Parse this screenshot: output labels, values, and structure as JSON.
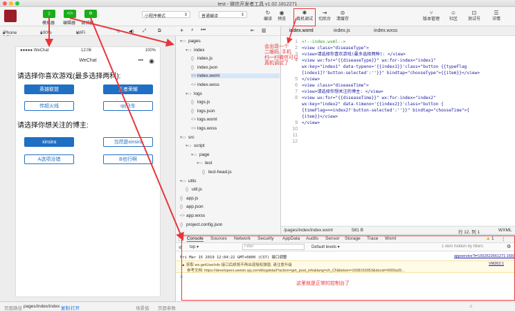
{
  "window": {
    "title": "test - 微信开发者工具 v1.02.1812271",
    "traffic_colors": [
      "#fc5f57",
      "#fdbc2e",
      "#2ac840"
    ]
  },
  "toolbar": {
    "buttons": [
      {
        "label": "模拟器",
        "icon": "phone-icon"
      },
      {
        "label": "编辑器",
        "icon": "code-icon"
      },
      {
        "label": "调试器",
        "icon": "debug-icon"
      }
    ],
    "mode_select": "小程序模式",
    "compile_select": "普通编译",
    "tools": [
      {
        "label": "编译",
        "icon": "refresh-icon"
      },
      {
        "label": "预览",
        "icon": "eye-icon"
      },
      {
        "label": "真机调试",
        "icon": "bug-icon"
      },
      {
        "label": "切后台",
        "icon": "switch-icon"
      },
      {
        "label": "清缓存",
        "icon": "layers-icon"
      }
    ],
    "right_tools": [
      {
        "label": "版本管理",
        "icon": "branch-icon"
      },
      {
        "label": "社区",
        "icon": "chat-icon"
      },
      {
        "label": "测试号",
        "icon": "test-icon"
      },
      {
        "label": "详情",
        "icon": "menu-icon"
      }
    ]
  },
  "subbar": {
    "device": "iPhone 6 Plus",
    "zoom": "100%",
    "network": "WiFi",
    "arrow": "▾"
  },
  "phone": {
    "carrier": "●●●●● WeChat",
    "time": "12:06",
    "battery": "100%",
    "nav_title": "WeChat",
    "nav_dots": "•••",
    "q1": "请选择你喜欢游戏(最多选择两科):",
    "games": [
      {
        "label": "英雄联盟",
        "selected": true
      },
      {
        "label": "王者荣耀",
        "selected": true
      },
      {
        "label": "传超火线",
        "selected": false
      },
      {
        "label": "qq飞车",
        "selected": false
      }
    ],
    "q2": "请选择你想关注的博主:",
    "bloggers": [
      {
        "label": "xinsira",
        "selected": true
      },
      {
        "label": "当然是xinsira",
        "selected": false
      },
      {
        "label": "A选项没错",
        "selected": false
      },
      {
        "label": "B也行啊",
        "selected": false
      }
    ]
  },
  "filetree": {
    "nodes": [
      {
        "label": "pages",
        "icon": "folder-icon",
        "depth": 0
      },
      {
        "label": "index",
        "icon": "folder-icon",
        "depth": 1
      },
      {
        "label": "index.js",
        "icon": "js-file-icon",
        "depth": 2
      },
      {
        "label": "index.json",
        "icon": "json-file-icon",
        "depth": 2
      },
      {
        "label": "index.wxml",
        "icon": "wxml-file-icon",
        "depth": 2,
        "selected": true
      },
      {
        "label": "index.wxss",
        "icon": "wxss-file-icon",
        "depth": 2
      },
      {
        "label": "logs",
        "icon": "folder-icon",
        "depth": 1
      },
      {
        "label": "logs.js",
        "icon": "js-file-icon",
        "depth": 2
      },
      {
        "label": "logs.json",
        "icon": "json-file-icon",
        "depth": 2
      },
      {
        "label": "logs.wxml",
        "icon": "wxml-file-icon",
        "depth": 2
      },
      {
        "label": "logs.wxss",
        "icon": "wxss-file-icon",
        "depth": 2
      },
      {
        "label": "src",
        "icon": "folder-icon",
        "depth": 0
      },
      {
        "label": "script",
        "icon": "folder-icon",
        "depth": 1
      },
      {
        "label": "page",
        "icon": "folder-icon",
        "depth": 2
      },
      {
        "label": "test",
        "icon": "folder-icon",
        "depth": 3
      },
      {
        "label": "test-head.js",
        "icon": "js-file-icon",
        "depth": 4
      },
      {
        "label": "utils",
        "icon": "folder-icon",
        "depth": 0
      },
      {
        "label": "util.js",
        "icon": "js-file-icon",
        "depth": 1
      },
      {
        "label": "app.js",
        "icon": "js-file-icon",
        "depth": 0
      },
      {
        "label": "app.json",
        "icon": "json-file-icon",
        "depth": 0
      },
      {
        "label": "app.wxss",
        "icon": "wxss-file-icon",
        "depth": 0
      },
      {
        "label": "project.config.json",
        "icon": "json-file-icon",
        "depth": 0
      }
    ]
  },
  "editor": {
    "tabs": [
      "index.wxml",
      "index.js",
      "index.wxss"
    ],
    "active_tab": "index.wxml",
    "lines": [
      {
        "n": "1",
        "text": "<!--index.wxml-->",
        "comment": true
      },
      {
        "n": "2",
        "text": "<view class=\"diseaseType\">"
      },
      {
        "n": "3",
        "text": "  <view>请选择你喜欢游戏(最多选择两种): </view>"
      },
      {
        "n": "4",
        "text": "  <view wx:for=\"{{diseaseType}}\" wx:for-index=\"index1\""
      },
      {
        "n": "",
        "text": "wx:key=\"index1\" data-typeno='{{index1}}'class=\"button {{typeFlag"
      },
      {
        "n": "",
        "text": "[index1]?'button-selected':''}}\" bindtap=\"chooseType\">{{item}}</view>"
      },
      {
        "n": "5",
        "text": "</view>"
      },
      {
        "n": "6",
        "text": "<view class=\"diseaseTime\">"
      },
      {
        "n": "7",
        "text": "  <view>请选择你想关注的博主: </view>"
      },
      {
        "n": "8",
        "text": "  <view wx:for=\"{{diseaseTime}}\" wx:for-index=\"index2\""
      },
      {
        "n": "",
        "text": "wx:key=\"index2\" data-timeno='{{index2}}'class=\"button {"
      },
      {
        "n": "",
        "text": "{timeFlag===index2?'button-selected':''}}\" bindtap=\"chooseTime\">{"
      },
      {
        "n": "",
        "text": "{item}}</view>"
      },
      {
        "n": "9",
        "text": "</view>"
      },
      {
        "n": "10",
        "text": ""
      },
      {
        "n": "11",
        "text": ""
      },
      {
        "n": "12",
        "text": ""
      }
    ],
    "status_path": "/pages/index/index.wxml",
    "status_size": "581 B",
    "status_pos": "行 12, 列 1",
    "status_lang": "WXML"
  },
  "devtools": {
    "tabs": [
      "Console",
      "Sources",
      "Network",
      "Security",
      "AppData",
      "Audits",
      "Sensor",
      "Storage",
      "Trace",
      "Wxml"
    ],
    "active_tab": "Console",
    "warn_count": "1",
    "context": "top",
    "filter_placeholder": "Filter",
    "levels": "Default levels ▾",
    "hidden_note": "1 item hidden by filters",
    "log1_time": "Fri Mar 15 2019 12:04:22 GMT+0800 (CST) 接口调整",
    "log1_src": "appservice?t=1552622661271:1693",
    "warn1": "▲ 获取 wx.getUserInfo 接口后续将不再出现授权弹窗, 请注意升级",
    "warn1_src": "VM262:1",
    "warn2": "参考文档: https://developers.weixin.qq.com/blogdetail?action=get_post_info&lang=zh_CN&token=1658163953&docid=0000a26...",
    "prompt": ">"
  },
  "bottombar": {
    "path_label": "页面路径",
    "path": "pages/index/index",
    "copy": "复制",
    "open": "打开",
    "scene": "场景值",
    "params": "页面参数"
  },
  "annotations": {
    "note1": "会出现一个",
    "note2": "二维码, 手机",
    "note3": "扫一扫微信可以",
    "note4": "真机调试了",
    "console_note": "这里就是正常的控制台了"
  },
  "colors": {
    "annotation": "#e8353a",
    "wechat_green": "#1aad19",
    "button_blue": "#1f6fc2"
  }
}
